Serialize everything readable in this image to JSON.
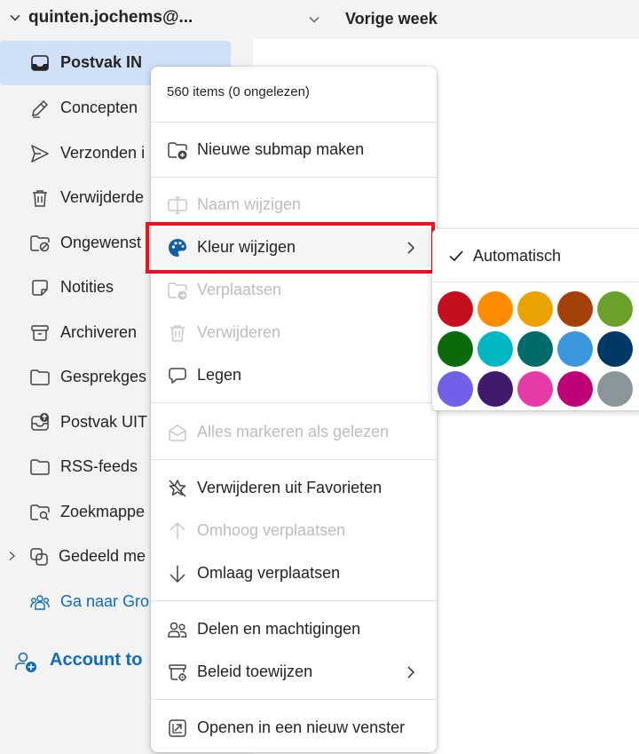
{
  "nav": {
    "account_name": "quinten.jochems@...",
    "folders": [
      {
        "label": "Postvak IN",
        "icon": "inbox-icon"
      },
      {
        "label": "Concepten",
        "icon": "pencil-icon"
      },
      {
        "label": "Verzonden i",
        "icon": "send-icon"
      },
      {
        "label": "Verwijderde",
        "icon": "trash-icon"
      },
      {
        "label": "Ongewenst",
        "icon": "junk-folder-icon"
      },
      {
        "label": "Notities",
        "icon": "note-icon"
      },
      {
        "label": "Archiveren",
        "icon": "archive-icon"
      },
      {
        "label": "Gesprekges",
        "icon": "folder-icon"
      },
      {
        "label": "Postvak UIT",
        "icon": "outbox-icon"
      },
      {
        "label": "RSS-feeds",
        "icon": "folder-icon"
      },
      {
        "label": "Zoekmappe",
        "icon": "search-folder-icon"
      },
      {
        "label": "Gedeeld me",
        "icon": "shared-icon"
      },
      {
        "label": "Ga naar Gro",
        "icon": "groups-icon"
      }
    ],
    "account_tools": "Account to"
  },
  "list": {
    "group_header": "Vorige week"
  },
  "menu": {
    "info": "560 items (0 ongelezen)",
    "items": [
      {
        "label": "Nieuwe submap maken",
        "icon": "new-folder-icon",
        "disabled": false
      },
      {
        "label": "Naam wijzigen",
        "icon": "rename-icon",
        "disabled": true
      },
      {
        "label": "Kleur wijzigen",
        "icon": "palette-icon",
        "disabled": false
      },
      {
        "label": "Verplaatsen",
        "icon": "move-folder-icon",
        "disabled": true
      },
      {
        "label": "Verwijderen",
        "icon": "trash-icon",
        "disabled": true
      },
      {
        "label": "Legen",
        "icon": "empty-icon",
        "disabled": false
      },
      {
        "label": "Alles markeren als gelezen",
        "icon": "mark-read-icon",
        "disabled": true
      },
      {
        "label": "Verwijderen uit Favorieten",
        "icon": "star-off-icon",
        "disabled": false
      },
      {
        "label": "Omhoog verplaatsen",
        "icon": "arrow-up-icon",
        "disabled": true
      },
      {
        "label": "Omlaag verplaatsen",
        "icon": "arrow-down-icon",
        "disabled": false
      },
      {
        "label": "Delen en machtigingen",
        "icon": "people-icon",
        "disabled": false
      },
      {
        "label": "Beleid toewijzen",
        "icon": "policy-icon",
        "disabled": false
      },
      {
        "label": "Openen in een nieuw venster",
        "icon": "open-window-icon",
        "disabled": false
      }
    ]
  },
  "color_submenu": {
    "auto_label": "Automatisch",
    "swatches": [
      "#c50f1f",
      "#ff8c00",
      "#eaa300",
      "#a4400a",
      "#6ba02a",
      "#0b6a0b",
      "#00b7c3",
      "#006b6b",
      "#3a96dd",
      "#003966",
      "#7160e8",
      "#401b6c",
      "#e43ba6",
      "#bf0077",
      "#8a9699"
    ]
  },
  "colors": {
    "accent": "#0f6cbd",
    "selected_bg": "#cfe0f7",
    "highlight_border": "#e8141e"
  }
}
